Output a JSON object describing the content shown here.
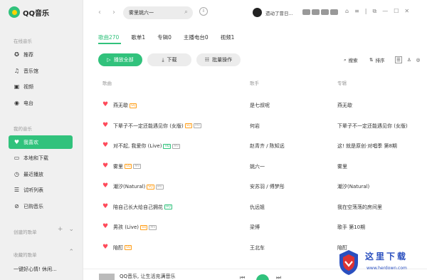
{
  "app": {
    "name": "QQ音乐"
  },
  "sidebar": {
    "online_title": "在线音乐",
    "online_items": [
      {
        "label": "推荐",
        "icon": "star-icon"
      },
      {
        "label": "音乐馆",
        "icon": "music-note-icon"
      },
      {
        "label": "视频",
        "icon": "video-icon"
      },
      {
        "label": "电台",
        "icon": "radio-icon"
      }
    ],
    "mine_title": "我的音乐",
    "mine_items": [
      {
        "label": "我喜欢",
        "icon": "heart-icon",
        "active": true
      },
      {
        "label": "本地和下载",
        "icon": "monitor-icon"
      },
      {
        "label": "最近播放",
        "icon": "clock-icon"
      },
      {
        "label": "试听列表",
        "icon": "list-icon"
      },
      {
        "label": "已购音乐",
        "icon": "purchased-icon"
      }
    ],
    "created_title": "创建的歌单",
    "collected_title": "收藏的歌单",
    "collected_items": [
      {
        "label": "一键好心情! 休闲..."
      }
    ]
  },
  "topbar": {
    "search_value": "雾里姚六一",
    "username": "遗动了冒日..."
  },
  "tabs": [
    {
      "label": "歌曲270",
      "active": true
    },
    {
      "label": "歌单1"
    },
    {
      "label": "专辑0"
    },
    {
      "label": "主播电台0"
    },
    {
      "label": "视频1"
    }
  ],
  "actions": {
    "play_all": "播放全部",
    "download": "下载",
    "batch": "批量操作",
    "search": "搜索",
    "sort": "排序"
  },
  "columns": {
    "title": "歌曲",
    "singer": "歌手",
    "album": "专辑"
  },
  "songs": [
    {
      "title": "燕无歇",
      "tags": [
        "SQ"
      ],
      "singer": "是七叔呢",
      "album": "燕无歇"
    },
    {
      "title": "下辈子不一定还能遇见你 (女版)",
      "tags": [
        "SQ",
        "MV"
      ],
      "singer": "何岩",
      "album": "下辈子不一定还能遇见你 (女版)"
    },
    {
      "title": "对不起, 我爱你 (Live)",
      "tags": [
        "HQ",
        "MV"
      ],
      "singer": "赵青齐 / 陈知远",
      "album": "这! 就是原创·对唱季 第8期"
    },
    {
      "title": "雾里",
      "tags": [
        "SQ",
        "MV"
      ],
      "singer": "姚六一",
      "album": "雾里"
    },
    {
      "title": "潮汐(Natural)",
      "tags": [
        "SQ",
        "MV"
      ],
      "singer": "安苏羽 / 傅梦彤",
      "album": "潮汐(Natural)"
    },
    {
      "title": "陪自己长大给自己拥花",
      "tags": [
        "HQ"
      ],
      "singer": "仇远姐",
      "album": "我在空荡荡的房间里"
    },
    {
      "title": "男孩 (Live)",
      "tags": [
        "SQ",
        "MV"
      ],
      "singer": "梁博",
      "album": "歌手 第10期"
    },
    {
      "title": "陪酊",
      "tags": [
        "SQ"
      ],
      "singer": "王北车",
      "album": "陪酊"
    }
  ],
  "player": {
    "title": "QQ音乐, 让生活充满音乐"
  },
  "watermark": {
    "text": "这里下载",
    "url": "www.herdown.com"
  }
}
